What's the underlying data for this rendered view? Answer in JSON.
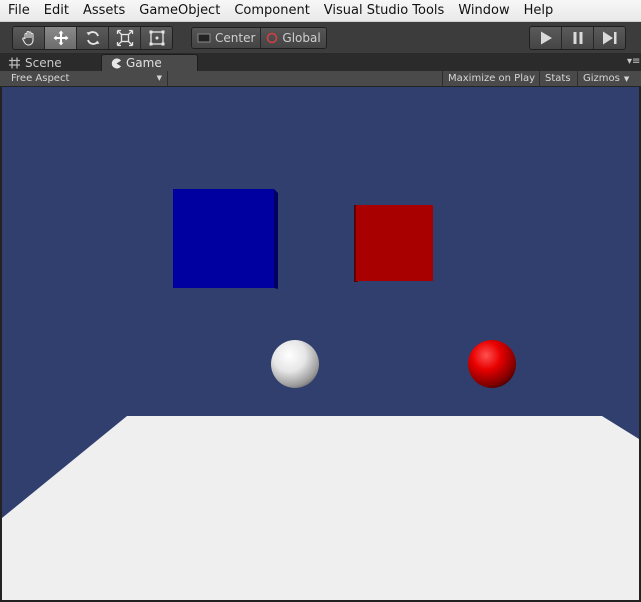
{
  "menubar": {
    "items": [
      "File",
      "Edit",
      "Assets",
      "GameObject",
      "Component",
      "Visual Studio Tools",
      "Window",
      "Help"
    ]
  },
  "toolbar": {
    "tools": [
      {
        "name": "hand-tool",
        "icon": "hand-icon",
        "active": false
      },
      {
        "name": "move-tool",
        "icon": "move-arrows-icon",
        "active": true
      },
      {
        "name": "rotate-tool",
        "icon": "rotate-icon",
        "active": false
      },
      {
        "name": "scale-tool",
        "icon": "scale-icon",
        "active": false
      },
      {
        "name": "rect-tool",
        "icon": "rect-icon",
        "active": false
      }
    ],
    "pivot_label": "Center",
    "space_label": "Global",
    "play_icon": "play-icon",
    "pause_icon": "pause-icon",
    "step_icon": "step-icon"
  },
  "tabs": {
    "scene_label": "Scene",
    "game_label": "Game"
  },
  "game_toolbar": {
    "aspect_label": "Free Aspect",
    "maximize_label": "Maximize on Play",
    "stats_label": "Stats",
    "gizmos_label": "Gizmos"
  },
  "colors": {
    "sky": "#303f6e",
    "floor": "#efefef",
    "blue_cube": "#0000a0",
    "red_cube": "#a80000",
    "white_sphere": "#f0f0f0",
    "red_sphere": "#e00000"
  }
}
